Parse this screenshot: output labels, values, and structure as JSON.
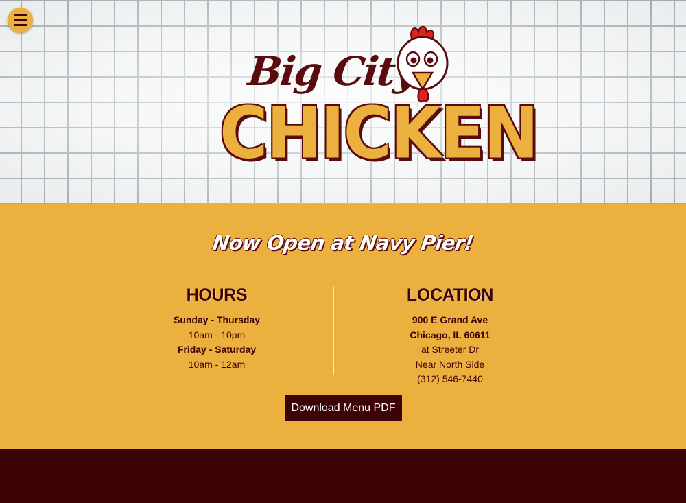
{
  "nav": {
    "menu_icon": "hamburger-icon"
  },
  "logo": {
    "line1": "Big City",
    "line2": "CHICKEN",
    "mascot_icon": "chicken-mascot-icon"
  },
  "tagline": "Now Open at Navy Pier!",
  "hours": {
    "title": "HOURS",
    "lines": [
      {
        "text": "Sunday - Thursday",
        "bold": true
      },
      {
        "text": "10am - 10pm",
        "bold": false
      },
      {
        "text": "Friday - Saturday",
        "bold": true
      },
      {
        "text": "10am - 12am",
        "bold": false
      }
    ]
  },
  "location": {
    "title": "LOCATION",
    "lines": [
      {
        "text": "900 E Grand Ave",
        "bold": true
      },
      {
        "text": "Chicago, IL 60611",
        "bold": true
      },
      {
        "text": "at Streeter Dr",
        "bold": false
      },
      {
        "text": "Near North Side",
        "bold": false
      },
      {
        "text": "(312) 546-7440",
        "bold": false
      }
    ]
  },
  "download_button": "Download Menu PDF",
  "colors": {
    "gold": "#ecb03f",
    "maroon": "#3d0405",
    "brick_grout": "#9aa1a6"
  }
}
